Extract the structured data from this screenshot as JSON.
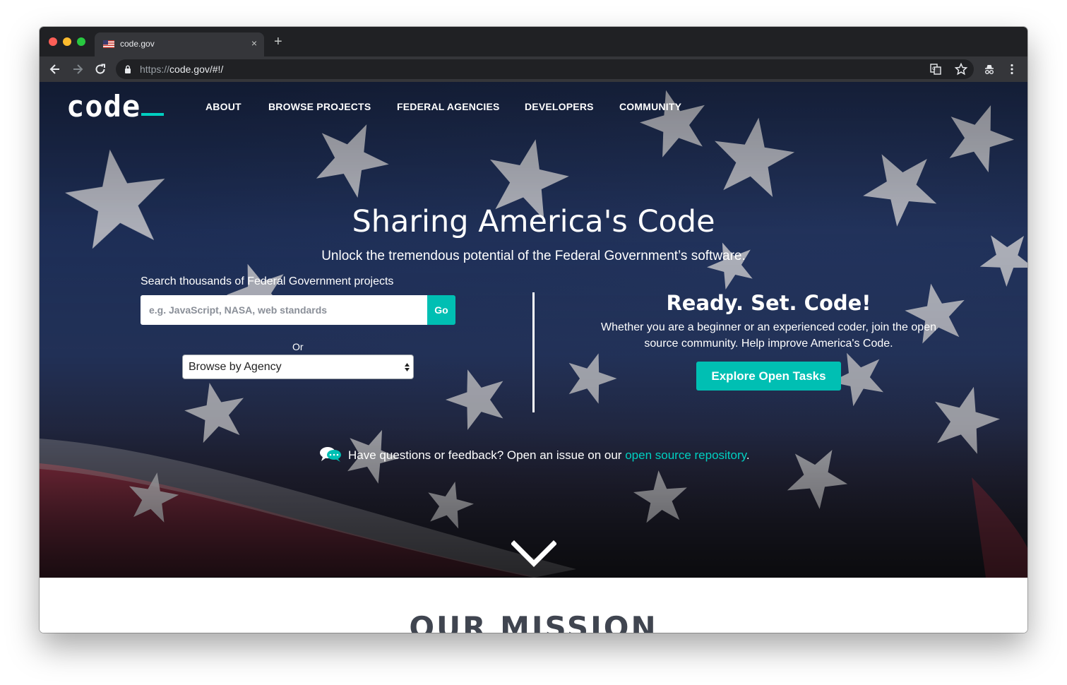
{
  "browser": {
    "tab_title": "code.gov",
    "new_tab": "+",
    "tab_close": "×",
    "url_scheme": "https://",
    "url_rest": "code.gov/#!/"
  },
  "site": {
    "logo": "code",
    "accent_color": "#00bfb3",
    "nav": [
      "ABOUT",
      "BROWSE PROJECTS",
      "FEDERAL AGENCIES",
      "DEVELOPERS",
      "COMMUNITY"
    ]
  },
  "hero": {
    "title": "Sharing America's Code",
    "subtitle": "Unlock the tremendous potential of the Federal Government’s software.",
    "search_label": "Search thousands of Federal Government projects",
    "search_placeholder": "e.g. JavaScript, NASA, web standards",
    "go_label": "Go",
    "or_label": "Or",
    "agency_select": "Browse by Agency",
    "ready_title": "Ready. Set. Code!",
    "ready_text": "Whether you are a beginner or an experienced coder, join the open source community. Help improve America's Code.",
    "explore_label": "Explore Open Tasks",
    "feedback_prefix": "Have questions or feedback? Open an issue on our ",
    "feedback_link": "open source repository",
    "feedback_suffix": "."
  },
  "mission": {
    "title": "OUR MISSION"
  }
}
